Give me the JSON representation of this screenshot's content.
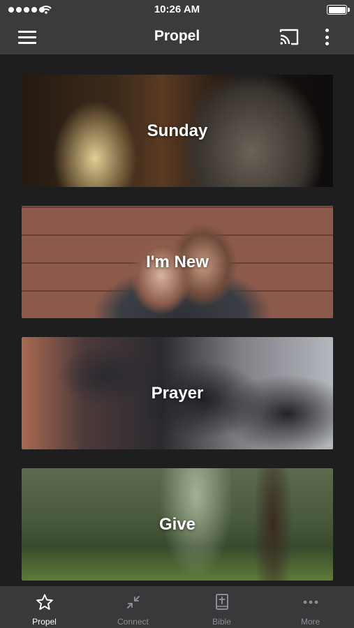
{
  "status_bar": {
    "time": "10:26 AM"
  },
  "app_bar": {
    "title": "Propel"
  },
  "cards": [
    {
      "label": "Sunday"
    },
    {
      "label": "I'm New"
    },
    {
      "label": "Prayer"
    },
    {
      "label": "Give"
    }
  ],
  "bottom_nav": {
    "items": [
      {
        "label": "Propel",
        "icon": "star-icon",
        "active": true
      },
      {
        "label": "Connect",
        "icon": "connect-arrows-icon",
        "active": false
      },
      {
        "label": "Bible",
        "icon": "bible-icon",
        "active": false
      },
      {
        "label": "More",
        "icon": "more-horizontal-icon",
        "active": false
      }
    ]
  },
  "colors": {
    "bar_background": "#3a3b3d",
    "page_background": "#1e1e1f",
    "nav_inactive": "#8d8e91"
  }
}
